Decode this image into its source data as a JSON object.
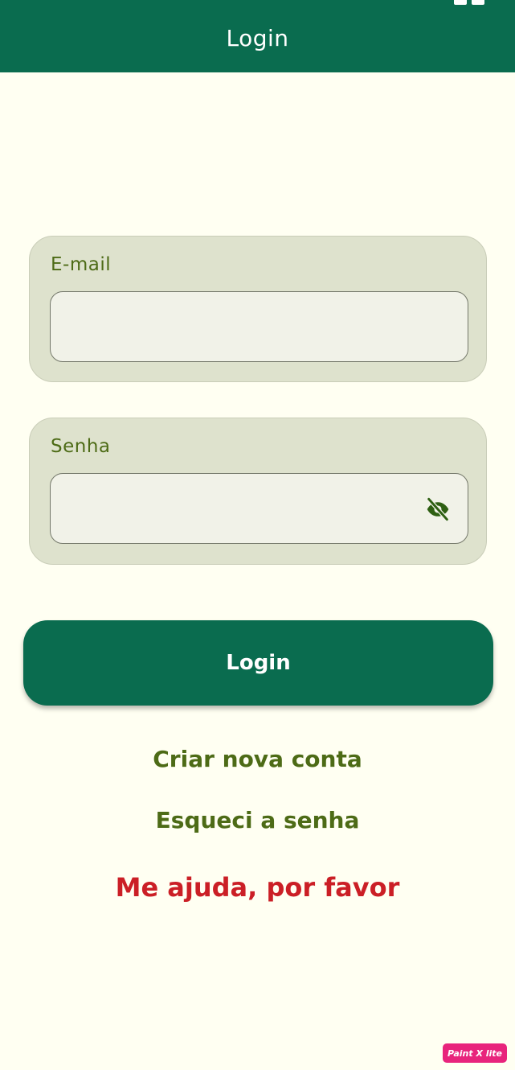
{
  "app_bar": {
    "title": "Login",
    "color": "#0a6c4f"
  },
  "email": {
    "label": "E-mail",
    "value": "",
    "placeholder": ""
  },
  "password": {
    "label": "Senha",
    "value": "",
    "placeholder": "",
    "toggle_icon": "eye-off-icon"
  },
  "login_button": {
    "label": "Login"
  },
  "links": {
    "create_account": "Criar nova conta",
    "forgot_password": "Esqueci a senha",
    "help": "Me ajuda, por favor"
  },
  "colors": {
    "primary": "#0a6c4f",
    "background": "#fffff2",
    "card": "#dee2cd",
    "link": "#4d6b16",
    "danger": "#cb1f26"
  },
  "watermark": "Paint X lite"
}
